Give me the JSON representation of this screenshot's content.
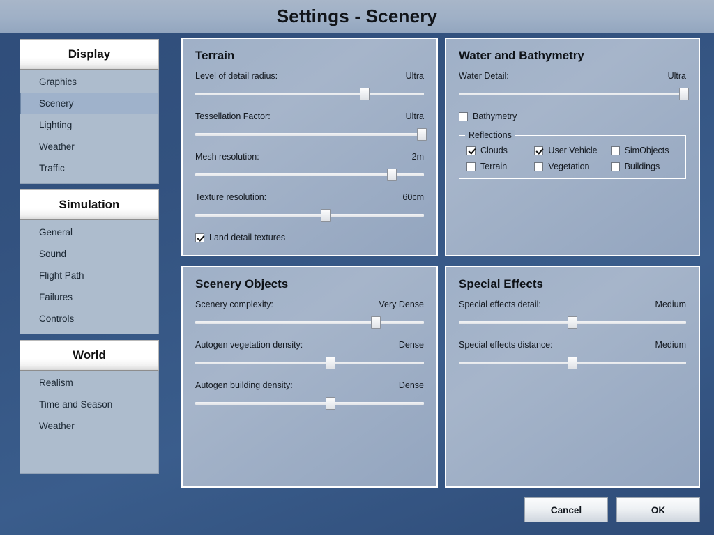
{
  "window": {
    "title": "Settings - Scenery"
  },
  "sidebar": {
    "groups": [
      {
        "header": "Display",
        "items": [
          {
            "label": "Graphics",
            "selected": false
          },
          {
            "label": "Scenery",
            "selected": true
          },
          {
            "label": "Lighting",
            "selected": false
          },
          {
            "label": "Weather",
            "selected": false
          },
          {
            "label": "Traffic",
            "selected": false
          }
        ]
      },
      {
        "header": "Simulation",
        "items": [
          {
            "label": "General",
            "selected": false
          },
          {
            "label": "Sound",
            "selected": false
          },
          {
            "label": "Flight Path",
            "selected": false
          },
          {
            "label": "Failures",
            "selected": false
          },
          {
            "label": "Controls",
            "selected": false
          }
        ]
      },
      {
        "header": "World",
        "items": [
          {
            "label": "Realism",
            "selected": false
          },
          {
            "label": "Time and Season",
            "selected": false
          },
          {
            "label": "Weather",
            "selected": false
          }
        ]
      }
    ]
  },
  "panels": {
    "terrain": {
      "title": "Terrain",
      "sliders": [
        {
          "label": "Level of detail radius:",
          "value": "Ultra",
          "percent": 74
        },
        {
          "label": "Tessellation Factor:",
          "value": "Ultra",
          "percent": 99
        },
        {
          "label": "Mesh resolution:",
          "value": "2m",
          "percent": 86
        },
        {
          "label": "Texture resolution:",
          "value": "60cm",
          "percent": 57
        }
      ],
      "checkbox": {
        "label": "Land detail textures",
        "checked": true
      }
    },
    "water": {
      "title": "Water and Bathymetry",
      "sliders": [
        {
          "label": "Water Detail:",
          "value": "Ultra",
          "percent": 99
        }
      ],
      "checkbox": {
        "label": "Bathymetry",
        "checked": false
      },
      "reflections": {
        "legend": "Reflections",
        "options": [
          {
            "label": "Clouds",
            "checked": true
          },
          {
            "label": "User Vehicle",
            "checked": true
          },
          {
            "label": "SimObjects",
            "checked": false
          },
          {
            "label": "Terrain",
            "checked": false
          },
          {
            "label": "Vegetation",
            "checked": false
          },
          {
            "label": "Buildings",
            "checked": false
          }
        ]
      }
    },
    "scenery_objects": {
      "title": "Scenery Objects",
      "sliders": [
        {
          "label": "Scenery complexity:",
          "value": "Very Dense",
          "percent": 79
        },
        {
          "label": "Autogen vegetation density:",
          "value": "Dense",
          "percent": 59
        },
        {
          "label": "Autogen building density:",
          "value": "Dense",
          "percent": 59
        }
      ]
    },
    "special_effects": {
      "title": "Special Effects",
      "sliders": [
        {
          "label": "Special effects detail:",
          "value": "Medium",
          "percent": 50
        },
        {
          "label": "Special effects distance:",
          "value": "Medium",
          "percent": 50
        }
      ]
    }
  },
  "footer": {
    "cancel_label": "Cancel",
    "ok_label": "OK"
  },
  "colors": {
    "background": "#33527f",
    "panel_fill": "#a1b2c8",
    "panel_border": "#ffffff",
    "selected_nav": "#9fb2cb",
    "titlebar": "#9fb0c6"
  }
}
